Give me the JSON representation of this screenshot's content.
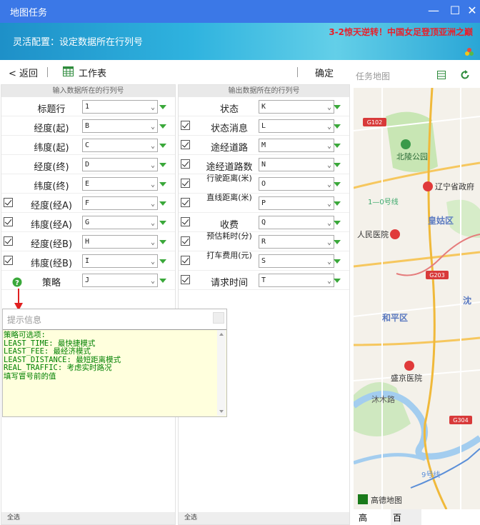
{
  "window": {
    "title": "地图任务",
    "controls": [
      "minimize-icon",
      "maximize-icon",
      "close-icon"
    ]
  },
  "banner": {
    "config_text": "灵活配置：设定数据所在行列号",
    "news": "3-2惊天逆转！中国女足登顶亚洲之巅"
  },
  "toolbar": {
    "back": "< 返回",
    "worksheet": "工作表",
    "confirm": "确定"
  },
  "input_panel": {
    "header": "输入数据所在的行列号",
    "rows": [
      {
        "label": "标题行",
        "value": "1",
        "checked": false
      },
      {
        "label": "经度(起)",
        "value": "B",
        "checked": false
      },
      {
        "label": "纬度(起)",
        "value": "C",
        "checked": false
      },
      {
        "label": "经度(终)",
        "value": "D",
        "checked": false
      },
      {
        "label": "纬度(终)",
        "value": "E",
        "checked": false
      },
      {
        "label": "经度(经A)",
        "value": "F",
        "checked": true
      },
      {
        "label": "纬度(经A)",
        "value": "G",
        "checked": true
      },
      {
        "label": "经度(经B)",
        "value": "H",
        "checked": true
      },
      {
        "label": "纬度(经B)",
        "value": "I",
        "checked": true
      },
      {
        "label": "策略",
        "value": "J",
        "checked": false
      }
    ],
    "footer": "全选"
  },
  "output_panel": {
    "header": "输出数据所在的行列号",
    "rows": [
      {
        "label": "状态",
        "value": "K",
        "checked": false
      },
      {
        "label": "状态消息",
        "value": "L",
        "checked": true
      },
      {
        "label": "途经道路",
        "value": "M",
        "checked": true
      },
      {
        "label": "途经道路数",
        "value": "N",
        "checked": true
      },
      {
        "label": "行驶距离(米)",
        "value": "O",
        "checked": true
      },
      {
        "label": "直线距离(米)",
        "value": "P",
        "checked": true
      },
      {
        "label": "收费",
        "value": "Q",
        "checked": true
      },
      {
        "label": "预估耗时(分)",
        "value": "R",
        "checked": true
      },
      {
        "label": "打车费用(元)",
        "value": "S",
        "checked": true
      },
      {
        "label": "请求时间",
        "value": "T",
        "checked": true
      }
    ],
    "footer": "全选"
  },
  "tip": {
    "title": "提示信息",
    "body": "策略可选项:\nLEAST_TIME: 最快捷模式\nLEAST_FEE: 最经济模式\nLEAST_DISTANCE: 最短距离模式\nREAL_TRAFFIC: 考虑实时路况\n填写冒号前的值"
  },
  "map": {
    "title": "任务地图",
    "labels": {
      "g102": "G102",
      "park": "北陵公园",
      "liaoning": "辽宁省政府",
      "line1": "1—0号线",
      "huangu": "皇姑区",
      "hospital1": "人民医院",
      "g203": "G203",
      "shen": "沈",
      "heping": "和平区",
      "shengjing": "盛京医院",
      "road": "沐木路",
      "g304": "G304",
      "line9": "9号线",
      "gaode": "高德地图"
    },
    "tabs": [
      "高",
      "百"
    ]
  }
}
